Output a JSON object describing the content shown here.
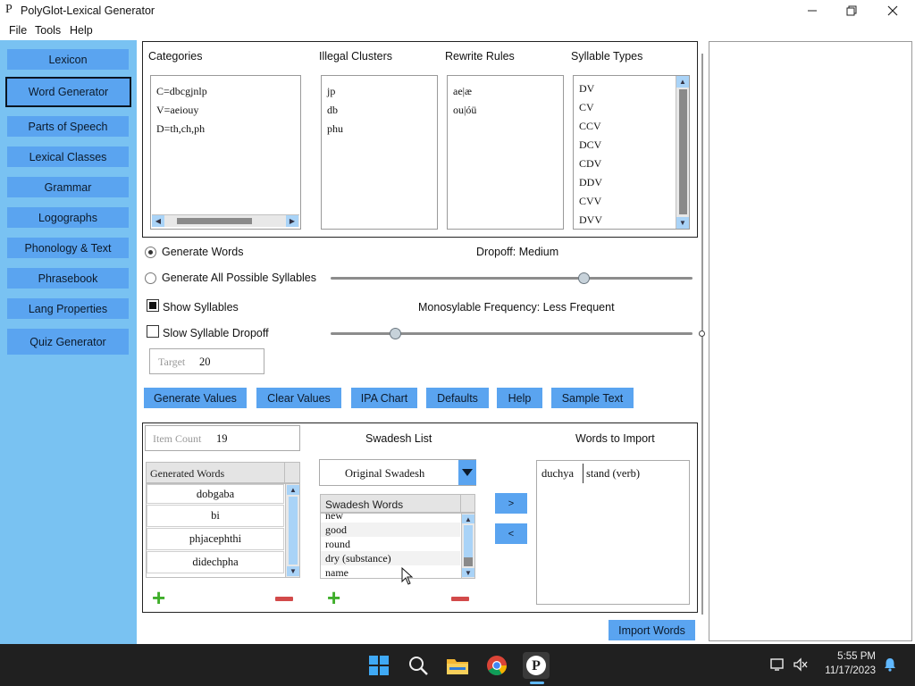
{
  "window": {
    "title": "PolyGlot-Lexical Generator",
    "app_icon_glyph": "P",
    "controls": [
      "minimize",
      "restore",
      "close"
    ]
  },
  "menu": [
    "File",
    "Tools",
    "Help"
  ],
  "sidebar": {
    "items": [
      {
        "label": "Lexicon",
        "selected": false
      },
      {
        "label": "Word Generator",
        "selected": true
      },
      {
        "label": "Parts of Speech",
        "selected": false
      },
      {
        "label": "Lexical Classes",
        "selected": false
      },
      {
        "label": "Grammar",
        "selected": false
      },
      {
        "label": "Logographs",
        "selected": false
      },
      {
        "label": "Phonology & Text",
        "selected": false
      },
      {
        "label": "Phrasebook",
        "selected": false
      },
      {
        "label": "Lang Properties",
        "selected": false
      },
      {
        "label": "Quiz Generator",
        "selected": false
      }
    ]
  },
  "rules_panel": {
    "categories": {
      "title": "Categories",
      "lines": [
        "C=dbcgjnlp",
        "V=aeiouy",
        "D=th,ch,ph"
      ]
    },
    "illegal_clusters": {
      "title": "Illegal Clusters",
      "lines": [
        "jp",
        "db",
        "phu"
      ]
    },
    "rewrite_rules": {
      "title": "Rewrite Rules",
      "lines": [
        "ae|æ",
        "ou|óü"
      ]
    },
    "syllable_types": {
      "title": "Syllable Types",
      "lines": [
        "DV",
        "CV",
        "CCV",
        "DCV",
        "CDV",
        "DDV",
        "CVV",
        "DVV"
      ]
    }
  },
  "options": {
    "generate_words": {
      "label": "Generate Words",
      "selected": true
    },
    "generate_all_syllables": {
      "label": "Generate All Possible Syllables",
      "selected": false
    },
    "show_syllables": {
      "label": "Show Syllables",
      "checked": true
    },
    "slow_syllable_dropoff": {
      "label": "Slow Syllable Dropoff",
      "checked": false
    },
    "dropoff_label": "Dropoff: Medium",
    "dropoff_value": 0.7,
    "mono_label": "Monosylable Frequency: Less Frequent",
    "mono_value": 0.18,
    "target_placeholder": "Target",
    "target_value": "20"
  },
  "action_buttons": [
    "Generate Values",
    "Clear Values",
    "IPA Chart",
    "Defaults",
    "Help",
    "Sample Text"
  ],
  "generated": {
    "item_count_placeholder": "Item Count",
    "item_count_value": "19",
    "header": "Generated Words",
    "words": [
      "dobgaba",
      "bi",
      "phjacephthi",
      "didechpha"
    ]
  },
  "swadesh": {
    "title": "Swadesh List",
    "dropdown_value": "Original Swadesh",
    "header": "Swadesh Words",
    "words": [
      "new",
      "good",
      "round",
      "dry (substance)",
      "name"
    ],
    "move_right": ">",
    "move_left": "<"
  },
  "import": {
    "title": "Words to Import",
    "rows": [
      {
        "word": "duchya",
        "meaning": "stand (verb)"
      }
    ],
    "import_button": "Import Words"
  },
  "taskbar": {
    "icons": [
      "windows-start-icon",
      "search-icon",
      "file-explorer-icon",
      "chrome-icon",
      "polyglot-icon"
    ],
    "time": "5:55 PM",
    "date": "11/17/2023"
  },
  "colors": {
    "sidebar_bg": "#79c2f2",
    "button_blue": "#5aa4f0",
    "taskbar": "#202020"
  }
}
